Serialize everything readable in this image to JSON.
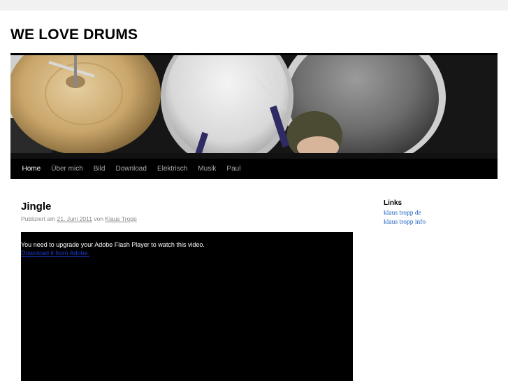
{
  "site": {
    "title": "WE LOVE DRUMS"
  },
  "nav": {
    "items": [
      {
        "label": "Home",
        "active": true
      },
      {
        "label": "Über mich",
        "active": false
      },
      {
        "label": "Bild",
        "active": false
      },
      {
        "label": "Download",
        "active": false
      },
      {
        "label": "Elektrisch",
        "active": false
      },
      {
        "label": "Musik",
        "active": false
      },
      {
        "label": "Paul",
        "active": false
      }
    ]
  },
  "post": {
    "title": "Jingle",
    "meta": {
      "prefix": "Publiziert am",
      "date": "21. Juni 2011",
      "by": "von",
      "author": "Klaus Tropp"
    },
    "video": {
      "message": "You need to upgrade your Adobe Flash Player to watch this video.",
      "link": "Download it from Adobe."
    }
  },
  "sidebar": {
    "widget_title": "Links",
    "links": [
      "klaus tropp de",
      "klaus tropp info"
    ]
  },
  "colors": {
    "nav_bg": "#000000",
    "link_blue": "#1a5fbf",
    "page_bg": "#f1f1f1"
  }
}
